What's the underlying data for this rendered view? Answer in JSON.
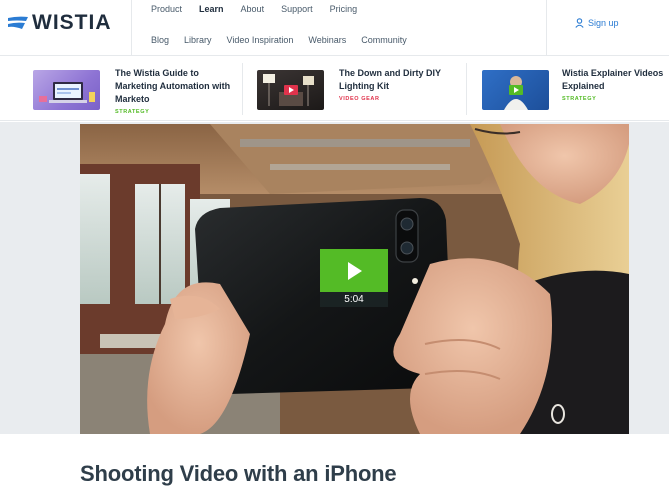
{
  "brand": {
    "name": "WISTIA",
    "logo_color": "#2b7cd3"
  },
  "nav": {
    "primary": [
      {
        "label": "Product",
        "active": false
      },
      {
        "label": "Learn",
        "active": true
      },
      {
        "label": "About",
        "active": false
      },
      {
        "label": "Support",
        "active": false
      },
      {
        "label": "Pricing",
        "active": false
      }
    ],
    "secondary": [
      {
        "label": "Blog"
      },
      {
        "label": "Library"
      },
      {
        "label": "Video Inspiration"
      },
      {
        "label": "Webinars"
      },
      {
        "label": "Community"
      }
    ],
    "signup_label": "Sign up",
    "signup_icon": "user-icon"
  },
  "featured": [
    {
      "title": "The Wistia Guide to Marketing Automation with Marketo",
      "tag": "STRATEGY",
      "tag_color": "#54bb26",
      "thumb": "marketing-automation-thumbnail"
    },
    {
      "title": "The Down and Dirty DIY Lighting Kit",
      "tag": "VIDEO GEAR",
      "tag_color": "#e0334c",
      "thumb": "lighting-kit-thumbnail"
    },
    {
      "title": "Wistia Explainer Videos Explained",
      "tag": "STRATEGY",
      "tag_color": "#54bb26",
      "thumb": "explainer-videos-thumbnail"
    }
  ],
  "video": {
    "duration": "5:04",
    "play_icon": "play-icon",
    "play_color": "#54bb26"
  },
  "article": {
    "title": "Shooting Video with an iPhone"
  }
}
